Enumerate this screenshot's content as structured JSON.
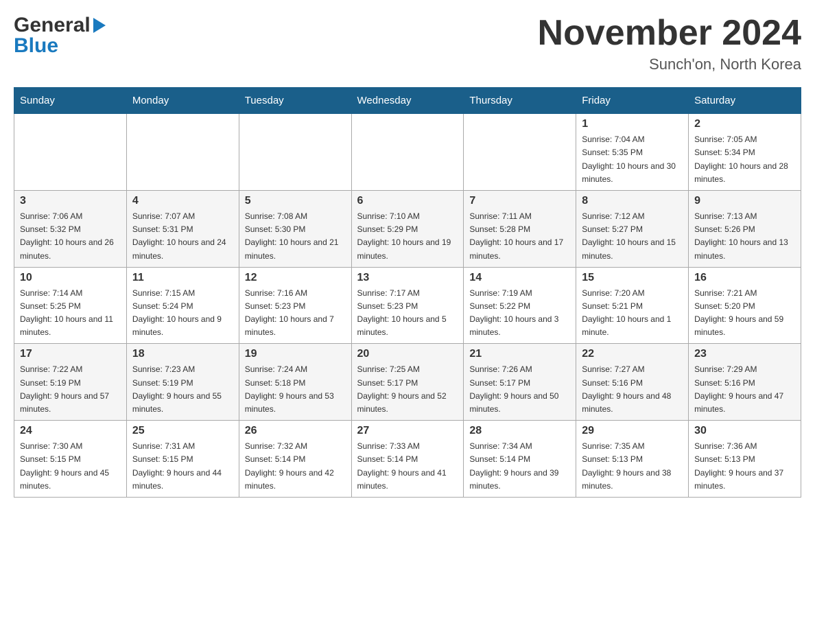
{
  "header": {
    "logo_general": "General",
    "logo_blue": "Blue",
    "month_title": "November 2024",
    "location": "Sunch'on, North Korea"
  },
  "days_of_week": [
    "Sunday",
    "Monday",
    "Tuesday",
    "Wednesday",
    "Thursday",
    "Friday",
    "Saturday"
  ],
  "weeks": [
    {
      "days": [
        {
          "number": "",
          "sunrise": "",
          "sunset": "",
          "daylight": ""
        },
        {
          "number": "",
          "sunrise": "",
          "sunset": "",
          "daylight": ""
        },
        {
          "number": "",
          "sunrise": "",
          "sunset": "",
          "daylight": ""
        },
        {
          "number": "",
          "sunrise": "",
          "sunset": "",
          "daylight": ""
        },
        {
          "number": "",
          "sunrise": "",
          "sunset": "",
          "daylight": ""
        },
        {
          "number": "1",
          "sunrise": "Sunrise: 7:04 AM",
          "sunset": "Sunset: 5:35 PM",
          "daylight": "Daylight: 10 hours and 30 minutes."
        },
        {
          "number": "2",
          "sunrise": "Sunrise: 7:05 AM",
          "sunset": "Sunset: 5:34 PM",
          "daylight": "Daylight: 10 hours and 28 minutes."
        }
      ]
    },
    {
      "days": [
        {
          "number": "3",
          "sunrise": "Sunrise: 7:06 AM",
          "sunset": "Sunset: 5:32 PM",
          "daylight": "Daylight: 10 hours and 26 minutes."
        },
        {
          "number": "4",
          "sunrise": "Sunrise: 7:07 AM",
          "sunset": "Sunset: 5:31 PM",
          "daylight": "Daylight: 10 hours and 24 minutes."
        },
        {
          "number": "5",
          "sunrise": "Sunrise: 7:08 AM",
          "sunset": "Sunset: 5:30 PM",
          "daylight": "Daylight: 10 hours and 21 minutes."
        },
        {
          "number": "6",
          "sunrise": "Sunrise: 7:10 AM",
          "sunset": "Sunset: 5:29 PM",
          "daylight": "Daylight: 10 hours and 19 minutes."
        },
        {
          "number": "7",
          "sunrise": "Sunrise: 7:11 AM",
          "sunset": "Sunset: 5:28 PM",
          "daylight": "Daylight: 10 hours and 17 minutes."
        },
        {
          "number": "8",
          "sunrise": "Sunrise: 7:12 AM",
          "sunset": "Sunset: 5:27 PM",
          "daylight": "Daylight: 10 hours and 15 minutes."
        },
        {
          "number": "9",
          "sunrise": "Sunrise: 7:13 AM",
          "sunset": "Sunset: 5:26 PM",
          "daylight": "Daylight: 10 hours and 13 minutes."
        }
      ]
    },
    {
      "days": [
        {
          "number": "10",
          "sunrise": "Sunrise: 7:14 AM",
          "sunset": "Sunset: 5:25 PM",
          "daylight": "Daylight: 10 hours and 11 minutes."
        },
        {
          "number": "11",
          "sunrise": "Sunrise: 7:15 AM",
          "sunset": "Sunset: 5:24 PM",
          "daylight": "Daylight: 10 hours and 9 minutes."
        },
        {
          "number": "12",
          "sunrise": "Sunrise: 7:16 AM",
          "sunset": "Sunset: 5:23 PM",
          "daylight": "Daylight: 10 hours and 7 minutes."
        },
        {
          "number": "13",
          "sunrise": "Sunrise: 7:17 AM",
          "sunset": "Sunset: 5:23 PM",
          "daylight": "Daylight: 10 hours and 5 minutes."
        },
        {
          "number": "14",
          "sunrise": "Sunrise: 7:19 AM",
          "sunset": "Sunset: 5:22 PM",
          "daylight": "Daylight: 10 hours and 3 minutes."
        },
        {
          "number": "15",
          "sunrise": "Sunrise: 7:20 AM",
          "sunset": "Sunset: 5:21 PM",
          "daylight": "Daylight: 10 hours and 1 minute."
        },
        {
          "number": "16",
          "sunrise": "Sunrise: 7:21 AM",
          "sunset": "Sunset: 5:20 PM",
          "daylight": "Daylight: 9 hours and 59 minutes."
        }
      ]
    },
    {
      "days": [
        {
          "number": "17",
          "sunrise": "Sunrise: 7:22 AM",
          "sunset": "Sunset: 5:19 PM",
          "daylight": "Daylight: 9 hours and 57 minutes."
        },
        {
          "number": "18",
          "sunrise": "Sunrise: 7:23 AM",
          "sunset": "Sunset: 5:19 PM",
          "daylight": "Daylight: 9 hours and 55 minutes."
        },
        {
          "number": "19",
          "sunrise": "Sunrise: 7:24 AM",
          "sunset": "Sunset: 5:18 PM",
          "daylight": "Daylight: 9 hours and 53 minutes."
        },
        {
          "number": "20",
          "sunrise": "Sunrise: 7:25 AM",
          "sunset": "Sunset: 5:17 PM",
          "daylight": "Daylight: 9 hours and 52 minutes."
        },
        {
          "number": "21",
          "sunrise": "Sunrise: 7:26 AM",
          "sunset": "Sunset: 5:17 PM",
          "daylight": "Daylight: 9 hours and 50 minutes."
        },
        {
          "number": "22",
          "sunrise": "Sunrise: 7:27 AM",
          "sunset": "Sunset: 5:16 PM",
          "daylight": "Daylight: 9 hours and 48 minutes."
        },
        {
          "number": "23",
          "sunrise": "Sunrise: 7:29 AM",
          "sunset": "Sunset: 5:16 PM",
          "daylight": "Daylight: 9 hours and 47 minutes."
        }
      ]
    },
    {
      "days": [
        {
          "number": "24",
          "sunrise": "Sunrise: 7:30 AM",
          "sunset": "Sunset: 5:15 PM",
          "daylight": "Daylight: 9 hours and 45 minutes."
        },
        {
          "number": "25",
          "sunrise": "Sunrise: 7:31 AM",
          "sunset": "Sunset: 5:15 PM",
          "daylight": "Daylight: 9 hours and 44 minutes."
        },
        {
          "number": "26",
          "sunrise": "Sunrise: 7:32 AM",
          "sunset": "Sunset: 5:14 PM",
          "daylight": "Daylight: 9 hours and 42 minutes."
        },
        {
          "number": "27",
          "sunrise": "Sunrise: 7:33 AM",
          "sunset": "Sunset: 5:14 PM",
          "daylight": "Daylight: 9 hours and 41 minutes."
        },
        {
          "number": "28",
          "sunrise": "Sunrise: 7:34 AM",
          "sunset": "Sunset: 5:14 PM",
          "daylight": "Daylight: 9 hours and 39 minutes."
        },
        {
          "number": "29",
          "sunrise": "Sunrise: 7:35 AM",
          "sunset": "Sunset: 5:13 PM",
          "daylight": "Daylight: 9 hours and 38 minutes."
        },
        {
          "number": "30",
          "sunrise": "Sunrise: 7:36 AM",
          "sunset": "Sunset: 5:13 PM",
          "daylight": "Daylight: 9 hours and 37 minutes."
        }
      ]
    }
  ]
}
